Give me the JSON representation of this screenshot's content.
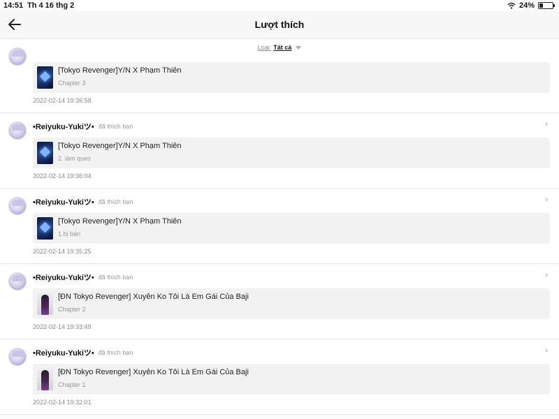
{
  "status": {
    "time": "14:51",
    "date": "Th 4 16 thg 2",
    "battery": "24%",
    "battery_level": 0.24
  },
  "header": {
    "title": "Lượt thích"
  },
  "filter": {
    "label": "Loại:",
    "value": "Tất cả"
  },
  "items": [
    {
      "user": "",
      "action": "",
      "story": "[Tokyo Revenger]Y/N X Phạm Thiên",
      "chapter": "Chapter 3",
      "time": "2022-02-14 19:36:58",
      "thumb": "blue"
    },
    {
      "user": "•Reiyuku-Yukiツ•",
      "action": "đã thích bạn",
      "story": "[Tokyo Revenger]Y/N X Phạm Thiên",
      "chapter": "2. làm quen",
      "time": "2022-02-14 19:36:04",
      "thumb": "blue"
    },
    {
      "user": "•Reiyuku-Yukiツ•",
      "action": "đã thích bạn",
      "story": "[Tokyo Revenger]Y/N X Phạm Thiên",
      "chapter": "1 bị bán",
      "time": "2022-02-14 19:35:25",
      "thumb": "blue"
    },
    {
      "user": "•Reiyuku-Yukiツ•",
      "action": "đã thích bạn",
      "story": "[ĐN Tokyo Revenger] Xuyên Ko Tôi Là Em Gái Của Baji",
      "chapter": "Chapter 2",
      "time": "2022-02-14 19:33:49",
      "thumb": "dark"
    },
    {
      "user": "•Reiyuku-Yukiツ•",
      "action": "đã thích bạn",
      "story": "[ĐN Tokyo Revenger] Xuyên Ko Tôi Là Em Gái Của Baji",
      "chapter": "Chapter 1",
      "time": "2022-02-14 19:32:01",
      "thumb": "dark"
    }
  ],
  "icons": {
    "back": "back-arrow-icon",
    "chevron": "chevron-right-icon",
    "wifi": "wifi-icon",
    "battery": "battery-icon",
    "dropdown": "dropdown-triangle-icon"
  }
}
